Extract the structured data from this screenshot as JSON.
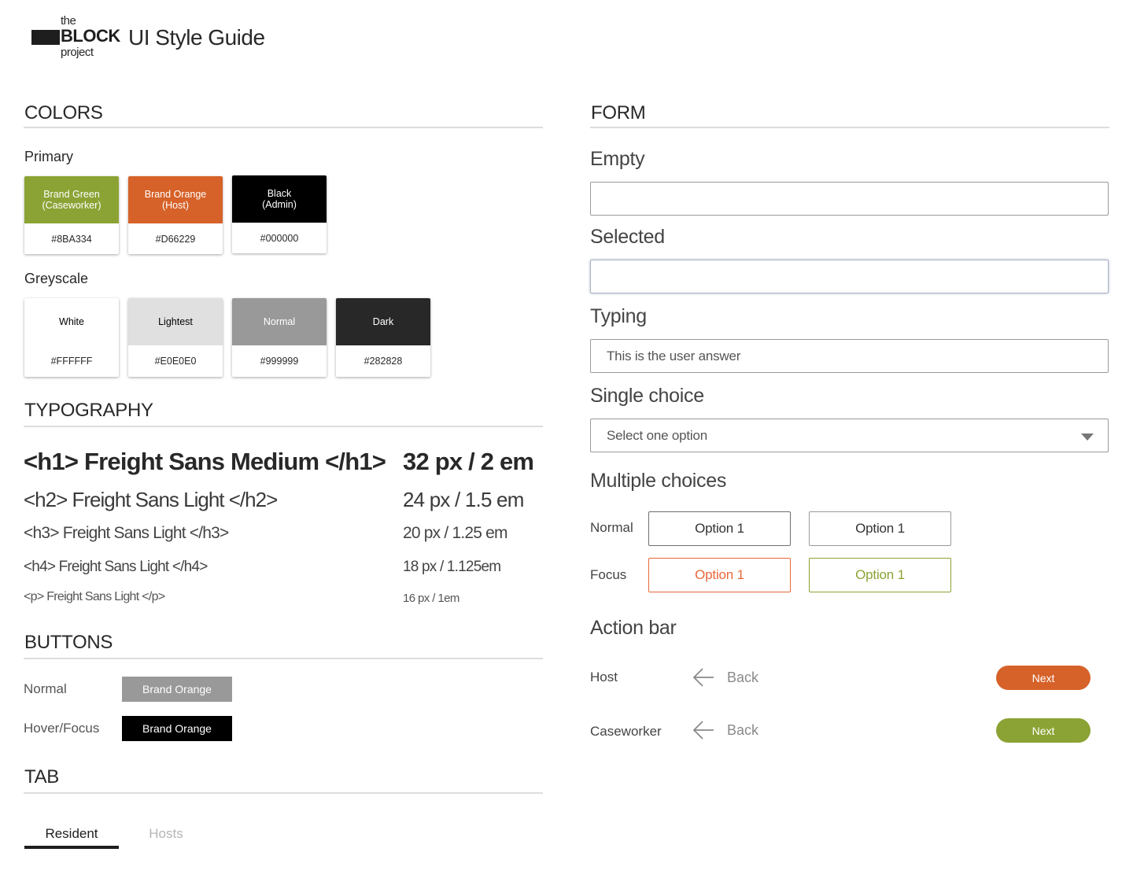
{
  "header": {
    "logo": {
      "the": "the",
      "block": "BLOCK",
      "project": "project"
    },
    "title": "UI Style Guide"
  },
  "colors": {
    "title": "COLORS",
    "primary_title": "Primary",
    "primary": [
      {
        "label": "Brand Green\n(Caseworker)",
        "code": "#8BA334",
        "bg": "#8BA334",
        "fg": "#ffffff"
      },
      {
        "label": "Brand Orange\n(Host)",
        "code": "#D66229",
        "bg": "#D66229",
        "fg": "#ffffff"
      },
      {
        "label": "Black\n(Admin)",
        "code": "#000000",
        "bg": "#000000",
        "fg": "#ffffff"
      }
    ],
    "greyscale_title": "Greyscale",
    "greyscale": [
      {
        "label": "White",
        "code": "#FFFFFF",
        "bg": "#FFFFFF",
        "fg": "#000000"
      },
      {
        "label": "Lightest",
        "code": "#E0E0E0",
        "bg": "#E0E0E0",
        "fg": "#000000"
      },
      {
        "label": "Normal",
        "code": "#999999",
        "bg": "#999999",
        "fg": "#ffffff"
      },
      {
        "label": "Dark",
        "code": "#282828",
        "bg": "#282828",
        "fg": "#ffffff"
      }
    ]
  },
  "typography": {
    "title": "TYPOGRAPHY",
    "rows": [
      {
        "sample": "<h1> Freight Sans Medium </h1>",
        "size": "32 px / 2 em"
      },
      {
        "sample": "<h2> Freight Sans Light </h2>",
        "size": "24 px / 1.5 em"
      },
      {
        "sample": "<h3> Freight Sans Light </h3>",
        "size": "20 px / 1.25 em"
      },
      {
        "sample": "<h4> Freight Sans Light </h4>",
        "size": "18 px / 1.125em"
      },
      {
        "sample": "<p> Freight Sans Light </p>",
        "size": "16 px / 1em"
      }
    ]
  },
  "buttons": {
    "title": "BUTTONS",
    "normal_label": "Normal",
    "normal_button": "Brand Orange",
    "normal_color": "#999999",
    "hover_label": "Hover/Focus",
    "hover_button": "Brand Orange",
    "hover_color": "#000000"
  },
  "tab": {
    "title": "TAB",
    "active": "Resident",
    "inactive": "Hosts"
  },
  "form": {
    "title": "FORM",
    "empty_label": "Empty",
    "selected_label": "Selected",
    "typing_label": "Typing",
    "typing_value": "This is the user answer",
    "single_label": "Single choice",
    "single_placeholder": "Select one option",
    "multiple_label": "Multiple choices",
    "normal_row": "Normal",
    "focus_row": "Focus",
    "option": "Option 1",
    "focus_orange": "#E8673A",
    "focus_green": "#8BA334"
  },
  "action_bar": {
    "title": "Action bar",
    "host_label": "Host",
    "caseworker_label": "Caseworker",
    "back": "Back",
    "next": "Next",
    "host_color": "#D66229",
    "caseworker_color": "#8BA334"
  }
}
